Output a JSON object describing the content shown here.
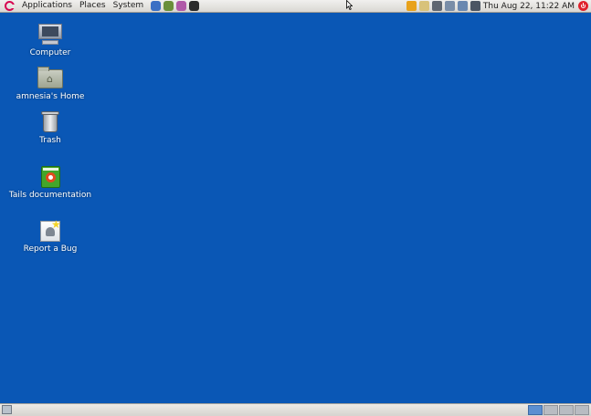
{
  "top_panel": {
    "menus": [
      "Applications",
      "Places",
      "System"
    ],
    "launchers": [
      {
        "icon": "browser-icon",
        "color": "#3a6fc4"
      },
      {
        "icon": "pidgin-icon",
        "color": "#6a8f3a"
      },
      {
        "icon": "email-icon",
        "color": "#b05aa8"
      },
      {
        "icon": "terminal-icon",
        "color": "#2b2b2b"
      }
    ],
    "tray_icons": [
      {
        "icon": "alert-icon",
        "color": "#e8a21c"
      },
      {
        "icon": "clipboard-icon",
        "color": "#d8c27a"
      },
      {
        "icon": "keyboard-icon",
        "color": "#5f6670"
      },
      {
        "icon": "tools-icon",
        "color": "#7a8ea8"
      },
      {
        "icon": "network-icon",
        "color": "#6a88b0"
      },
      {
        "icon": "volume-icon",
        "color": "#4b5563"
      }
    ],
    "clock": "Thu Aug 22, 11:22 AM"
  },
  "desktop": {
    "background": "#0a57b5",
    "icons": [
      {
        "label": "Computer",
        "icon": "computer-icon"
      },
      {
        "label": "amnesia's Home",
        "icon": "home-folder-icon"
      },
      {
        "label": "Trash",
        "icon": "trash-icon"
      },
      {
        "label": "Tails documentation",
        "icon": "tails-documentation-icon"
      },
      {
        "label": "Report a Bug",
        "icon": "report-bug-icon"
      }
    ]
  },
  "bottom_panel": {
    "workspaces": 4,
    "active_workspace": 1
  }
}
